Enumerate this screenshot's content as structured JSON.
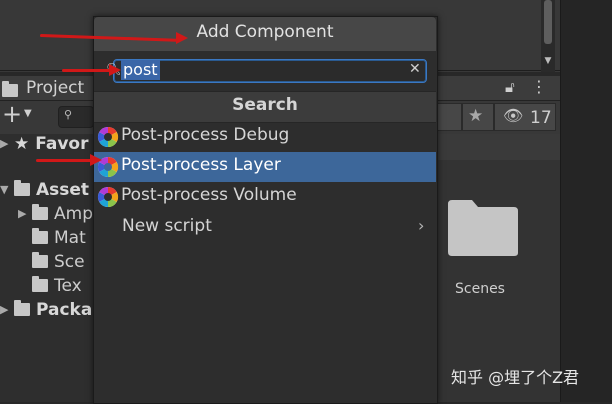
{
  "project_panel": {
    "tab_title": "Project",
    "hidden_count": "17",
    "tree": [
      {
        "label": "Favor",
        "bold": true,
        "icon": "star-icon",
        "expanded": true
      },
      {
        "label": "Asset",
        "bold": true,
        "icon": "folder-icon",
        "expanded": true
      },
      {
        "label": "Amp",
        "bold": false,
        "icon": "folder-icon",
        "expandable": true
      },
      {
        "label": "Mat",
        "bold": false,
        "icon": "folder-icon"
      },
      {
        "label": "Sce",
        "bold": false,
        "icon": "folder-icon"
      },
      {
        "label": "Tex",
        "bold": false,
        "icon": "folder-icon"
      },
      {
        "label": "Packa",
        "bold": true,
        "icon": "folder-icon",
        "expandable": true
      }
    ],
    "grid_items": [
      {
        "label": "Scenes",
        "icon": "folder-icon"
      }
    ]
  },
  "popup": {
    "title": "Add Component",
    "search": {
      "value": "post",
      "clear_icon": "close-icon"
    },
    "section_title": "Search",
    "results": [
      {
        "label": "Post-process Debug",
        "icon": "post-process-icon",
        "selected": false
      },
      {
        "label": "Post-process Layer",
        "icon": "post-process-icon",
        "selected": true
      },
      {
        "label": "Post-process Volume",
        "icon": "post-process-icon",
        "selected": false
      }
    ],
    "new_script": {
      "label": "New script",
      "chevron": "›"
    }
  },
  "watermark": "知乎 @埋了个Z君",
  "colors": {
    "selection": "#3d679a",
    "search_focus": "#3b78c2",
    "annotation_arrow": "#d11818",
    "editor_bg": "#383838"
  }
}
